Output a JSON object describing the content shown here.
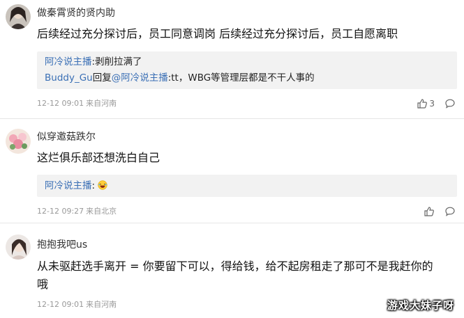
{
  "comments": [
    {
      "username": "做秦霄贤的贤内助",
      "content": "后续经过充分探讨后，员工同意调岗 后续经过充分探讨后，员工自愿离职",
      "replies": [
        {
          "name": "阿冷说主播",
          "text": ":剥削拉满了"
        },
        {
          "name": "Buddy_Gu",
          "mid": "回复",
          "target": "@阿冷说主播",
          "text": ":tt，WBG等管理层都是不干人事的"
        }
      ],
      "time": "12-12 09:01",
      "location": "来自河南",
      "like_count": "3"
    },
    {
      "username": "似穿邀菇跌尔",
      "content": "这烂俱乐部还想洗白自己",
      "replies": [
        {
          "name": "阿冷说主播",
          "text": ":"
        }
      ],
      "time": "12-12 09:27",
      "location": "来自北京",
      "like_count": ""
    },
    {
      "username": "抱抱我吧us",
      "content": "从未驱赶选手离开 = 你要留下可以，得给钱，给不起房租走了那可不是我赶你的哦",
      "time": "12-12 09:01",
      "location": "来自河南"
    }
  ],
  "watermark": "游戏大妹子呀",
  "icons": {
    "like": "thumbs-up-icon",
    "comment": "comment-bubble-icon",
    "emoji": "laughing-emoji-icon"
  },
  "colors": {
    "link": "#3a6fb5",
    "reply_bg": "#f2f2f2",
    "meta": "#999999"
  }
}
